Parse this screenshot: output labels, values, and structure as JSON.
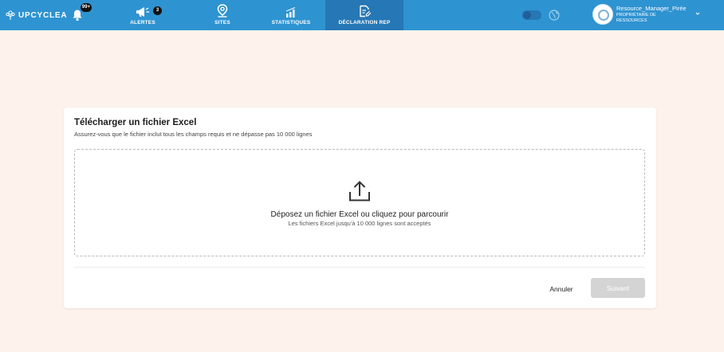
{
  "app": {
    "brand": "UPCYCLEA"
  },
  "notifications": {
    "count": "99+"
  },
  "nav": {
    "items": [
      {
        "label": "ALERTES",
        "icon": "megaphone-icon",
        "badge": "3"
      },
      {
        "label": "SITES",
        "icon": "map-pin-icon"
      },
      {
        "label": "STATISTIQUES",
        "icon": "bar-chart-icon"
      },
      {
        "label": "DÉCLARATION REP",
        "icon": "document-edit-icon",
        "active": true
      }
    ]
  },
  "user": {
    "name": "Resource_Manager_Pirée",
    "role": "PROPRIÉTAIRE DE RESSOURCES"
  },
  "upload": {
    "title": "Télécharger un fichier Excel",
    "subtitle": "Assurez-vous que le fichier inclut tous les champs requis et ne dépasse pas 10 000 lignes",
    "drop_primary": "Déposez un fichier Excel ou cliquez pour parcourir",
    "drop_secondary": "Les fichiers Excel jusqu'à 10 000 lignes sont acceptés"
  },
  "actions": {
    "cancel_label": "Annuler",
    "next_label": "Suivant"
  },
  "colors": {
    "topbar": "#2e93d1",
    "active_tab": "#2677b5",
    "page_background": "#fdf3ec",
    "disabled_button": "#d4d4d4"
  }
}
